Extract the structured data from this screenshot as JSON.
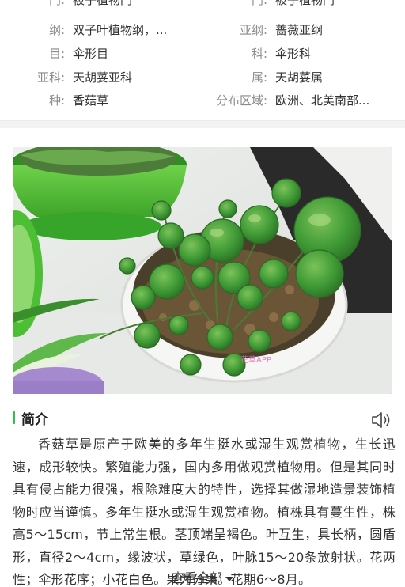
{
  "taxonomy": {
    "rows": [
      {
        "left_label": "门:",
        "left_value": "被子植物门",
        "right_label": "门:",
        "right_value": "被子植物门"
      },
      {
        "left_label": "纲:",
        "left_value": "双子叶植物纲，...",
        "right_label": "亚纲:",
        "right_value": "蔷薇亚纲"
      },
      {
        "left_label": "目:",
        "left_value": "伞形目",
        "right_label": "科:",
        "right_value": "伞形科"
      },
      {
        "left_label": "亚科:",
        "left_value": "天胡荽亚科",
        "right_label": "属:",
        "right_value": "天胡荽属"
      },
      {
        "left_label": "种:",
        "left_value": "香菇草",
        "right_label": "分布区域:",
        "right_value": "欧洲、北美南部..."
      }
    ]
  },
  "photo": {
    "watermark": "花草APP"
  },
  "intro": {
    "title": "简介",
    "text": "香菇草是原产于欧美的多年生挺水或湿生观赏植物，生长迅速，成形较快。繁殖能力强，国内多用做观赏植物用。但是其同时具有侵占能力很强，根除难度大的特性，选择其做湿地造景装饰植物时应当谨慎。多年生挺水或湿生观赏植物。植株具有蔓生性，株高5～15cm，节上常生根。茎顶端呈褐色。叶互生，具长柄，圆盾形，直径2～4cm，缘波状，草绿色，叶脉15～20条放射状。花两性；伞形花序；小花白色。果为分果。花期6～8月。",
    "view_all": "查看全部"
  },
  "colors": {
    "accent": "#2fbf4f",
    "divider": "#f3f3f3",
    "label": "#8a8a8a"
  }
}
